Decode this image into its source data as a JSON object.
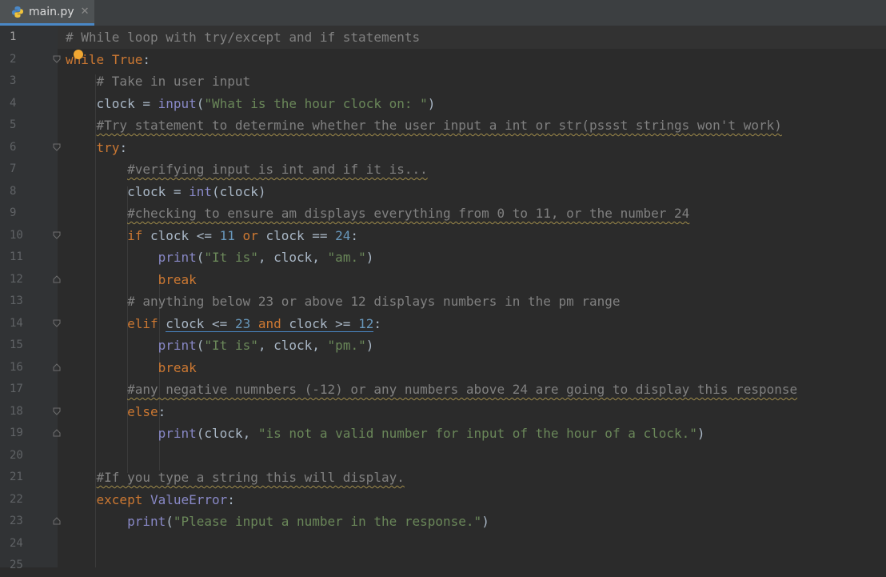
{
  "tab": {
    "filename": "main.py",
    "close": "✕"
  },
  "gutter": {
    "line_numbers": [
      "1",
      "2",
      "3",
      "4",
      "5",
      "6",
      "7",
      "8",
      "9",
      "10",
      "11",
      "12",
      "13",
      "14",
      "15",
      "16",
      "17",
      "18",
      "19",
      "20",
      "21",
      "22",
      "23",
      "24",
      "25"
    ]
  },
  "code": {
    "l1": "# While loop with try/except and if statements",
    "l2a": "while",
    "l2b": "True",
    "l2c": ":",
    "l3": "# Take in user input",
    "l4a": "clock = ",
    "l4b": "input",
    "l4c": "(",
    "l4d": "\"What is the hour clock on: \"",
    "l4e": ")",
    "l5": "#Try statement to determine whether the user input a int or str(pssst strings won't work)",
    "l6a": "try",
    "l6b": ":",
    "l7": "#verifying input is int and if it is...",
    "l8a": "clock = ",
    "l8b": "int",
    "l8c": "(clock)",
    "l9": "#checking to ensure am displays everything from 0 to 11, or the number 24",
    "l10a": "if",
    "l10b": " clock <= ",
    "l10c": "11",
    "l10d": " or",
    "l10e": " clock == ",
    "l10f": "24",
    "l10g": ":",
    "l11a": "print",
    "l11b": "(",
    "l11c": "\"It is\"",
    "l11d": ", clock, ",
    "l11e": "\"am.\"",
    "l11f": ")",
    "l12": "break",
    "l13": "# anything below 23 or above 12 displays numbers in the pm range",
    "l14a": "elif",
    "l14b": "clock <= ",
    "l14c": "23",
    "l14d": " and ",
    "l14e": "clock >= ",
    "l14f": "12",
    "l14g": ":",
    "l15a": "print",
    "l15b": "(",
    "l15c": "\"It is\"",
    "l15d": ", clock, ",
    "l15e": "\"pm.\"",
    "l15f": ")",
    "l16": "break",
    "l17": "#any negative numnbers (-12) or any numbers above 24 are going to display this response",
    "l18a": "else",
    "l18b": ":",
    "l19a": "print",
    "l19b": "(clock, ",
    "l19c": "\"is not a valid number for input of the hour of a clock.\"",
    "l19d": ")",
    "l21": "#If you type a string this will display.",
    "l22a": "except",
    "l22b": " ValueError",
    "l22c": ":",
    "l23a": "print",
    "l23b": "(",
    "l23c": "\"Please input a number in the response.\"",
    "l23d": ")"
  },
  "colors": {
    "background": "#2b2b2b",
    "keyword": "#cc7832",
    "comment": "#808080",
    "string": "#6a8759",
    "number": "#6897bb",
    "builtin": "#8888c6"
  }
}
